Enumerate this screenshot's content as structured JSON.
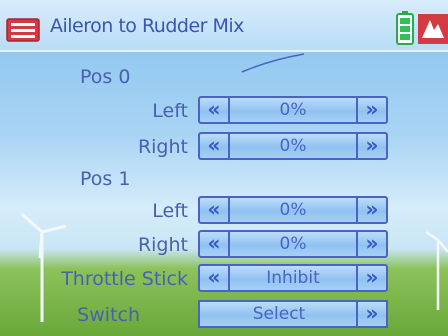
{
  "header": {
    "title": "Aileron to Rudder Mix",
    "menu_icon": "menu-icon",
    "battery_icon": "battery-icon",
    "signal_icon": "signal-icon"
  },
  "sections": [
    {
      "label": "Pos 0"
    },
    {
      "label": "Pos 1"
    }
  ],
  "rows": {
    "pos0_left": {
      "label": "Left",
      "value": "0%",
      "dec": "«",
      "inc": "»"
    },
    "pos0_right": {
      "label": "Right",
      "value": "0%",
      "dec": "«",
      "inc": "»"
    },
    "pos1_left": {
      "label": "Left",
      "value": "0%",
      "dec": "«",
      "inc": "»"
    },
    "pos1_right": {
      "label": "Right",
      "value": "0%",
      "dec": "«",
      "inc": "»"
    },
    "throttle": {
      "label": "Throttle Stick",
      "value": "Inhibit",
      "dec": "«",
      "inc": "»"
    },
    "switch": {
      "label": "Switch",
      "value": "Select",
      "inc": "»"
    }
  },
  "colors": {
    "accent": "#4a63c4",
    "text": "#4a5fb0",
    "title": "#3a55b4"
  }
}
